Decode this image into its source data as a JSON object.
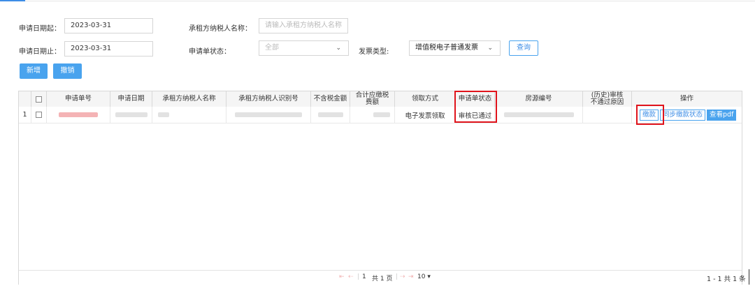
{
  "filters": {
    "date_start_label": "申请日期起：",
    "date_start_value": "2023-03-31",
    "date_end_label": "申请日期止：",
    "date_end_value": "2023-03-31",
    "tenant_name_label": "承租方纳税人名称：",
    "tenant_name_placeholder": "请输入承租方纳税人名称",
    "status_label": "申请单状态：",
    "status_value": "全部",
    "invoice_type_label": "发票类型:",
    "invoice_type_value": "增值税电子普通发票",
    "query_label": "查询"
  },
  "toolbar": {
    "add_label": "新增",
    "revoke_label": "撤销"
  },
  "table": {
    "columns": [
      "申请单号",
      "申请日期",
      "承租方纳税人名称",
      "承租方纳税人识别号",
      "不含税金额",
      "合计应缴税费额",
      "领取方式",
      "申请单状态",
      "房源编号",
      "(历史)审核不通过原因",
      "操作"
    ],
    "rows": [
      {
        "index": "1",
        "pickup_method": "电子发票领取",
        "status": "审核已通过",
        "reason": ""
      }
    ],
    "actions": {
      "pay": "缴款",
      "sync": "同步缴款状态",
      "view_pdf": "查看pdf"
    }
  },
  "pagination": {
    "first": "⇤",
    "prev": "⇠",
    "current_page": "1",
    "total_pages": "共 1 页",
    "next": "⇢",
    "last": "⇥",
    "page_size": "10 ▾",
    "summary": "1 - 1  共 1 条"
  },
  "colors": {
    "accent": "#49a3ee",
    "highlight": "#e0131b"
  }
}
